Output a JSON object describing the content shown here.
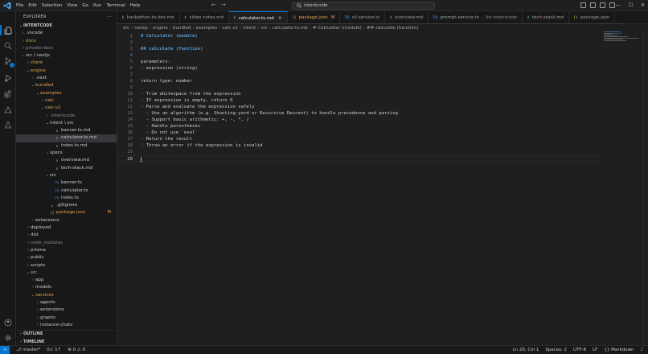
{
  "titlebar": {
    "menu": [
      "File",
      "Edit",
      "Selection",
      "View",
      "Go",
      "Run",
      "Terminal",
      "Help"
    ],
    "search_text": "intentcode",
    "win_minimize": "—",
    "win_maximize": "☐",
    "win_close": "✕"
  },
  "sidebar": {
    "header": "EXPLORER",
    "header_more": "···",
    "root_label": "INTENTCODE",
    "tree": [
      {
        "depth": 0,
        "chev": "›",
        "icon": "",
        "label": ".vscode",
        "color": "normal"
      },
      {
        "depth": 0,
        "chev": "›",
        "icon": "",
        "label": "docs",
        "color": "orange"
      },
      {
        "depth": 0,
        "chev": "›",
        "icon": "",
        "label": "private-docs",
        "color": "dim"
      },
      {
        "depth": 0,
        "chev": "⌄",
        "icon": "",
        "label": "src / nextjs",
        "color": "normal"
      },
      {
        "depth": 1,
        "chev": "›",
        "icon": "",
        "label": "client",
        "color": "orange"
      },
      {
        "depth": 1,
        "chev": "⌄",
        "icon": "",
        "label": "engine",
        "color": "orange"
      },
      {
        "depth": 2,
        "chev": "›",
        "icon": "",
        "label": ".next",
        "color": "normal"
      },
      {
        "depth": 2,
        "chev": "⌄",
        "icon": "",
        "label": "bundled",
        "color": "orange"
      },
      {
        "depth": 3,
        "chev": "⌄",
        "icon": "",
        "label": "examples",
        "color": "orange"
      },
      {
        "depth": 4,
        "chev": "›",
        "icon": "",
        "label": "calc",
        "color": "orange"
      },
      {
        "depth": 4,
        "chev": "⌄",
        "icon": "",
        "label": "calc-v2",
        "color": "orange"
      },
      {
        "depth": 5,
        "chev": "›",
        "icon": "",
        "label": ".intentcode",
        "color": "dim"
      },
      {
        "depth": 5,
        "chev": "⌄",
        "icon": "",
        "label": "intent \\ src",
        "color": "normal"
      },
      {
        "depth": 6,
        "chev": "",
        "icon": "md",
        "label": "banner.ts.md",
        "color": "normal"
      },
      {
        "depth": 6,
        "chev": "",
        "icon": "md",
        "label": "calculator.ts.md",
        "color": "normal",
        "selected": true
      },
      {
        "depth": 6,
        "chev": "",
        "icon": "md",
        "label": "index.ts.md",
        "color": "normal"
      },
      {
        "depth": 5,
        "chev": "⌄",
        "icon": "",
        "label": "specs",
        "color": "normal"
      },
      {
        "depth": 6,
        "chev": "",
        "icon": "md",
        "label": "overview.md",
        "color": "normal"
      },
      {
        "depth": 6,
        "chev": "",
        "icon": "md",
        "label": "tech-stack.md",
        "color": "normal"
      },
      {
        "depth": 5,
        "chev": "⌄",
        "icon": "",
        "label": "src",
        "color": "normal"
      },
      {
        "depth": 6,
        "chev": "",
        "icon": "ts",
        "label": "banner.ts",
        "color": "normal"
      },
      {
        "depth": 6,
        "chev": "",
        "icon": "ts",
        "label": "calculator.ts",
        "color": "normal"
      },
      {
        "depth": 6,
        "chev": "",
        "icon": "ts",
        "label": "index.ts",
        "color": "normal"
      },
      {
        "depth": 5,
        "chev": "",
        "icon": "git",
        "label": ".gitignore",
        "color": "normal"
      },
      {
        "depth": 5,
        "chev": "",
        "icon": "json",
        "label": "package.json",
        "color": "orange",
        "badge": "M"
      },
      {
        "depth": 2,
        "chev": "›",
        "icon": "",
        "label": "extensions",
        "color": "normal"
      },
      {
        "depth": 1,
        "chev": "›",
        "icon": "",
        "label": "deployed",
        "color": "normal"
      },
      {
        "depth": 1,
        "chev": "›",
        "icon": "",
        "label": "dist",
        "color": "normal"
      },
      {
        "depth": 1,
        "chev": "›",
        "icon": "",
        "label": "node_modules",
        "color": "dim"
      },
      {
        "depth": 1,
        "chev": "›",
        "icon": "",
        "label": "prisma",
        "color": "normal"
      },
      {
        "depth": 1,
        "chev": "›",
        "icon": "",
        "label": "public",
        "color": "normal"
      },
      {
        "depth": 1,
        "chev": "›",
        "icon": "",
        "label": "scripts",
        "color": "normal"
      },
      {
        "depth": 1,
        "chev": "⌄",
        "icon": "",
        "label": "src",
        "color": "orange"
      },
      {
        "depth": 2,
        "chev": "›",
        "icon": "",
        "label": "app",
        "color": "normal"
      },
      {
        "depth": 2,
        "chev": "›",
        "icon": "",
        "label": "models",
        "color": "normal"
      },
      {
        "depth": 2,
        "chev": "⌄",
        "icon": "",
        "label": "services",
        "color": "orange"
      },
      {
        "depth": 3,
        "chev": "›",
        "icon": "",
        "label": "agents",
        "color": "normal"
      },
      {
        "depth": 3,
        "chev": "›",
        "icon": "",
        "label": "extensions",
        "color": "normal"
      },
      {
        "depth": 3,
        "chev": "›",
        "icon": "",
        "label": "graphs",
        "color": "normal"
      },
      {
        "depth": 3,
        "chev": "›",
        "icon": "",
        "label": "instance-chats",
        "color": "normal"
      }
    ],
    "outline_label": "OUTLINE",
    "timeline_label": "TIMELINE"
  },
  "tabs": [
    {
      "icon": "md",
      "icon_text": "⬇",
      "label": "hackathon-to-dos.md",
      "extra": "",
      "active": false,
      "modified": false,
      "italic": false
    },
    {
      "icon": "md",
      "icon_text": "⬇",
      "label": "video notes.md",
      "extra": "",
      "active": false,
      "modified": false,
      "italic": false
    },
    {
      "icon": "md",
      "icon_text": "⬇",
      "label": "calculator.ts.md",
      "extra": "",
      "active": true,
      "modified": false,
      "italic": false
    },
    {
      "icon": "json",
      "icon_text": "{}",
      "label": "package.json",
      "extra": "",
      "active": false,
      "modified": true,
      "italic": false
    },
    {
      "icon": "ts",
      "icon_text": "TS",
      "label": "cli-service.ts",
      "extra": "",
      "active": false,
      "modified": false,
      "italic": false
    },
    {
      "icon": "md",
      "icon_text": "⬇",
      "label": "overview.md",
      "extra": "",
      "active": false,
      "modified": false,
      "italic": false
    },
    {
      "icon": "ts",
      "icon_text": "TS",
      "label": "prompt-service.ts",
      "extra": "...\\to-intentcode",
      "active": false,
      "modified": false,
      "italic": false
    },
    {
      "icon": "md",
      "icon_text": "⬇",
      "label": "tech-stack.md",
      "extra": "",
      "active": false,
      "modified": false,
      "italic": false
    },
    {
      "icon": "json",
      "icon_text": "{}",
      "label": "package.json",
      "extra": "",
      "active": false,
      "modified": false,
      "italic": true
    }
  ],
  "breadcrumb": [
    "src",
    "nextjs",
    "engine",
    "bundled",
    "examples",
    "calc-v2",
    "intent",
    "src",
    "calculator.ts.md",
    "# Calculator (module)",
    "## calculate (function)"
  ],
  "editor": {
    "cursor_line": 20,
    "lines": [
      {
        "n": "1",
        "text": "# Calculator (module)",
        "kind": "heading"
      },
      {
        "n": "2",
        "text": "",
        "kind": "plain"
      },
      {
        "n": "3",
        "text": "## calculate (function)",
        "kind": "heading"
      },
      {
        "n": "4",
        "text": "",
        "kind": "plain"
      },
      {
        "n": "5",
        "text": "parameters:",
        "kind": "plain"
      },
      {
        "n": "6",
        "text": "- expression (string)",
        "kind": "bullet"
      },
      {
        "n": "7",
        "text": "",
        "kind": "plain"
      },
      {
        "n": "8",
        "text": "return type: number",
        "kind": "plain"
      },
      {
        "n": "9",
        "text": "",
        "kind": "plain"
      },
      {
        "n": "10",
        "text": "- Trim whitespace from the expression",
        "kind": "bullet"
      },
      {
        "n": "11",
        "text": "- If expression is empty, return 0",
        "kind": "bullet"
      },
      {
        "n": "12",
        "text": "- Parse and evaluate the expression safely",
        "kind": "bullet"
      },
      {
        "n": "13",
        "text": "  - Use an algorithm (e.g. Shunting-yard or Recursive Descent) to handle precedence and parsing",
        "kind": "bullet"
      },
      {
        "n": "14",
        "text": "  - Support basic arithmetic: +, -, *, /",
        "kind": "bullet"
      },
      {
        "n": "15",
        "text": "  - Handle parentheses",
        "kind": "bullet"
      },
      {
        "n": "16",
        "text": "  - Do not use `eval`",
        "kind": "bullet"
      },
      {
        "n": "17",
        "text": "- Return the result",
        "kind": "bullet"
      },
      {
        "n": "18",
        "text": "- Throw an error if the expression is invalid",
        "kind": "bullet"
      },
      {
        "n": "19",
        "text": "",
        "kind": "plain"
      },
      {
        "n": "20",
        "text": "",
        "kind": "plain"
      }
    ]
  },
  "statusbar": {
    "branch": "master*",
    "sync": "0↓ 1↑",
    "errors": "⊗ 0 ⚠ 0",
    "position": "Ln 20, Col 1",
    "spaces": "Spaces: 2",
    "encoding": "UTF-8",
    "eol": "LF",
    "language": "{} Markdown",
    "bell": "🔔"
  },
  "colors": {
    "accent": "#0078d4",
    "modified": "#e2a354",
    "background": "#1f1f1f",
    "sidebar": "#181818"
  }
}
